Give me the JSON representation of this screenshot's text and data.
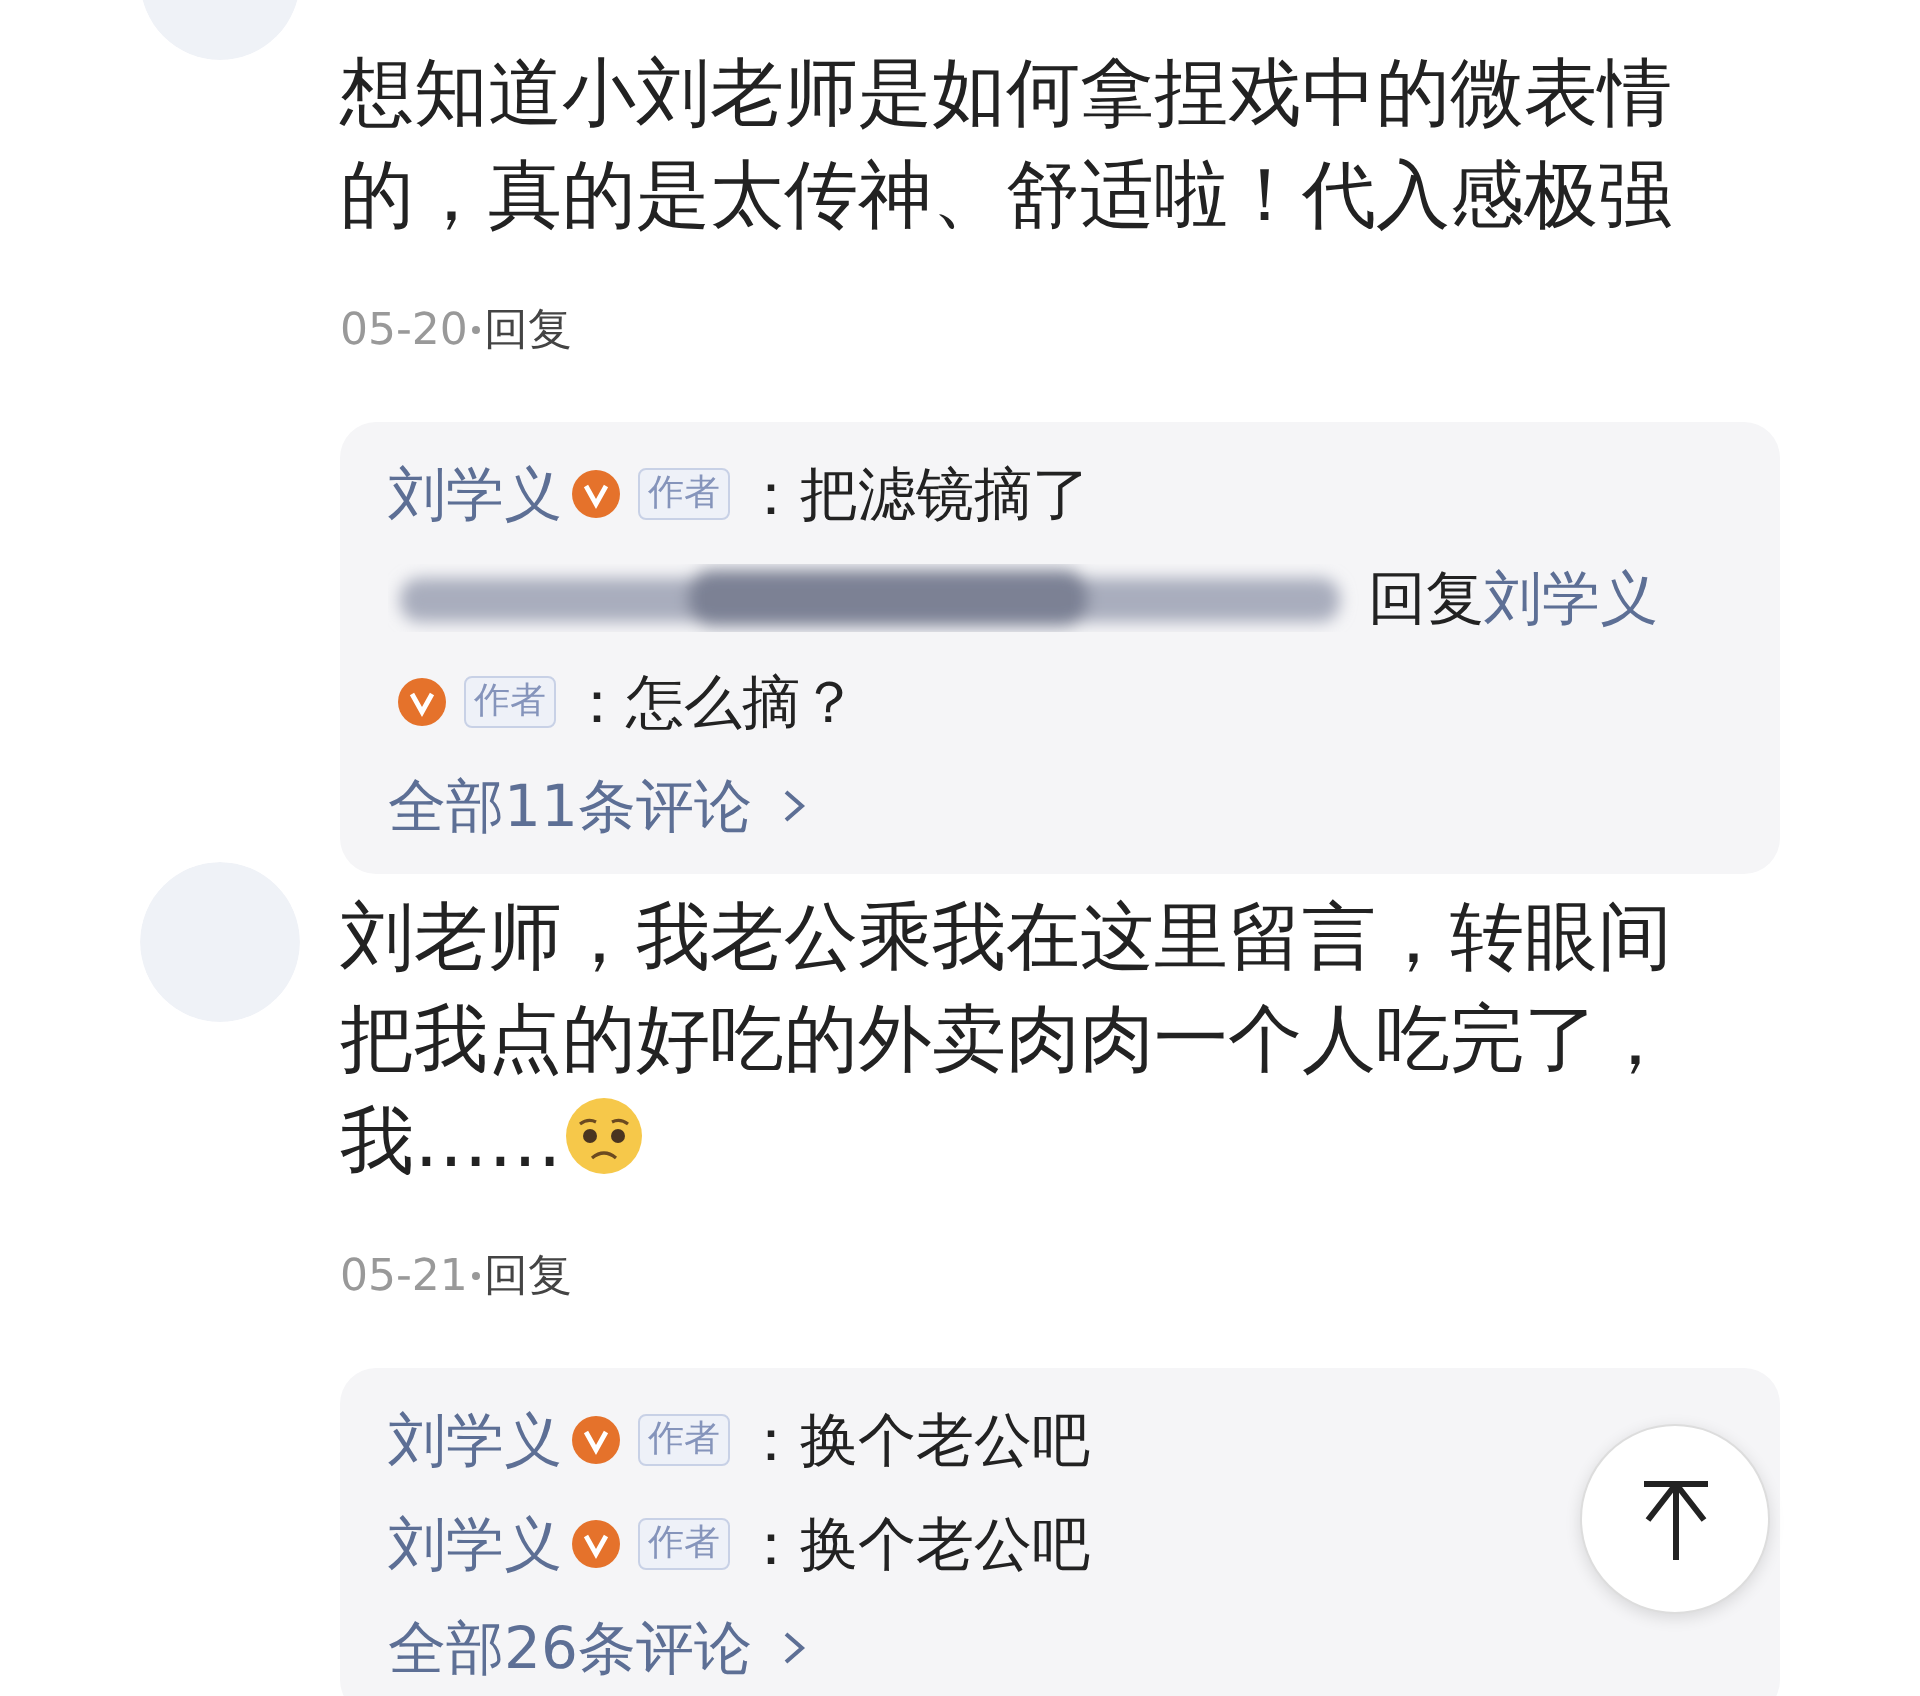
{
  "comments": [
    {
      "text": "想知道小刘老师是如何拿捏戏中的微表情的，真的是太传神、舒适啦！代入感极强",
      "date": "05-20",
      "reply_link": "回复",
      "replies": [
        {
          "kind": "comment",
          "name": "刘学义",
          "verified": true,
          "tag": "作者",
          "text": "：把滤镜摘了"
        },
        {
          "kind": "reply",
          "hidden_name": true,
          "reply_word": "回复",
          "target": "刘学义",
          "verified": true,
          "tag": "作者",
          "text": "：怎么摘？"
        }
      ],
      "more": "全部11条评论"
    },
    {
      "text": "刘老师，我老公乘我在这里留言，转眼间把我点的好吃的外卖肉肉一个人吃完了，我……",
      "emoji": true,
      "date": "05-21",
      "reply_link": "回复",
      "replies": [
        {
          "kind": "comment",
          "name": "刘学义",
          "verified": true,
          "tag": "作者",
          "text": "：换个老公吧"
        },
        {
          "kind": "comment",
          "name": "刘学义",
          "verified": true,
          "tag": "作者",
          "text": "：换个老公吧"
        }
      ],
      "more": "全部26条评论"
    }
  ],
  "back_to_top": true
}
